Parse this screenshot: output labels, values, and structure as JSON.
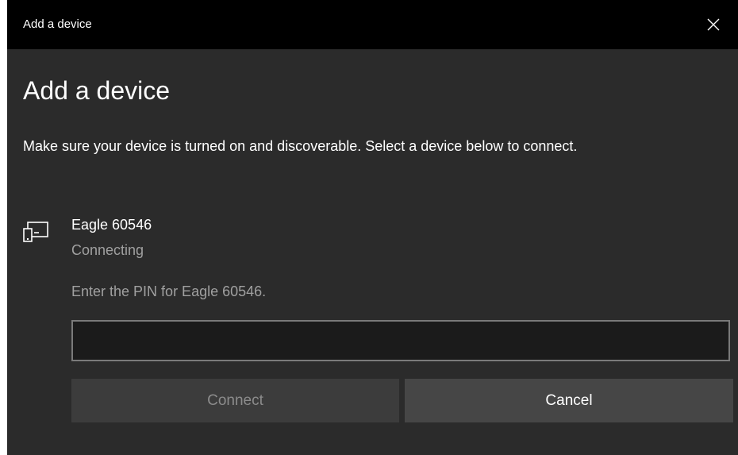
{
  "window": {
    "title": "Add a device",
    "close_icon": "close-icon"
  },
  "dialog": {
    "heading": "Add a device",
    "description": "Make sure your device is turned on and discoverable. Select a device below to connect."
  },
  "device": {
    "icon": "tablet-phone-icon",
    "name": "Eagle 60546",
    "status": "Connecting"
  },
  "pin": {
    "prompt": "Enter the PIN for Eagle 60546.",
    "value": "",
    "placeholder": ""
  },
  "buttons": {
    "connect_label": "Connect",
    "cancel_label": "Cancel"
  },
  "colors": {
    "title_bar": "#000000",
    "background": "#2b2b2b",
    "text": "#ffffff",
    "secondary_text": "#a0a0a0",
    "disabled_button": "#3c3c3c",
    "button": "#464646",
    "input_border": "#7a7a7a"
  }
}
